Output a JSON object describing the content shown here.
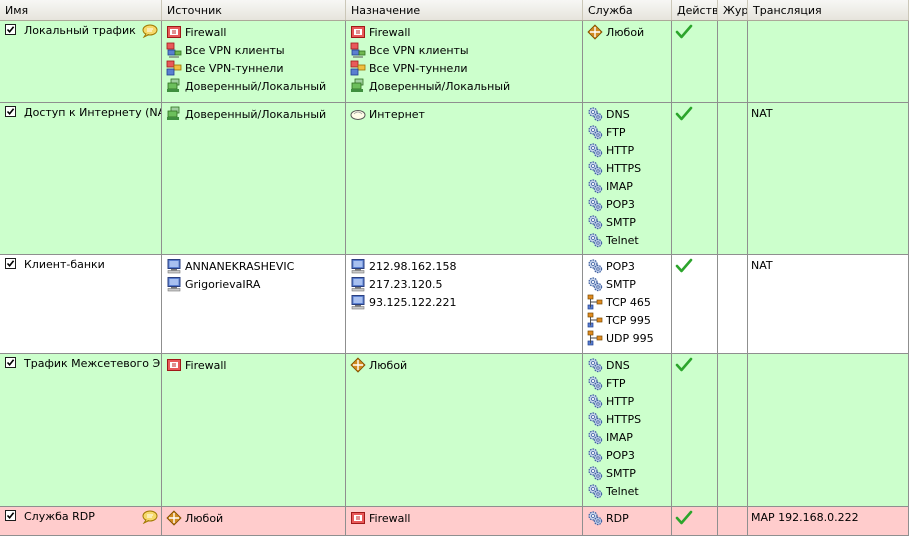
{
  "columns": [
    "Имя",
    "Источник",
    "Назначение",
    "Служба",
    "Действи",
    "Журн",
    "Трансляция"
  ],
  "rules": [
    {
      "name": "Локальный трафик",
      "color": "green",
      "comment": true,
      "source": [
        {
          "icon": "firewall-icon",
          "text": "Firewall"
        },
        {
          "icon": "vpn-clients-icon",
          "text": "Все VPN клиенты"
        },
        {
          "icon": "vpn-tunnels-icon",
          "text": "Все VPN-туннели"
        },
        {
          "icon": "trusted-network-icon",
          "text": "Доверенный/Локальный"
        }
      ],
      "destination": [
        {
          "icon": "firewall-icon",
          "text": "Firewall"
        },
        {
          "icon": "vpn-clients-icon",
          "text": "Все VPN клиенты"
        },
        {
          "icon": "vpn-tunnels-icon",
          "text": "Все VPN-туннели"
        },
        {
          "icon": "trusted-network-icon",
          "text": "Доверенный/Локальный"
        }
      ],
      "service": [
        {
          "icon": "any-icon",
          "text": "Любой"
        }
      ],
      "action": "allow",
      "translation": ""
    },
    {
      "name": "Доступ к Интернету (NAT)",
      "color": "green",
      "comment": false,
      "source": [
        {
          "icon": "trusted-network-icon",
          "text": "Доверенный/Локальный"
        }
      ],
      "destination": [
        {
          "icon": "internet-icon",
          "text": "Интернет"
        }
      ],
      "service": [
        {
          "icon": "service-gears-icon",
          "text": "DNS"
        },
        {
          "icon": "service-gears-icon",
          "text": "FTP"
        },
        {
          "icon": "service-gears-icon",
          "text": "HTTP"
        },
        {
          "icon": "service-gears-icon",
          "text": "HTTPS"
        },
        {
          "icon": "service-gears-icon",
          "text": "IMAP"
        },
        {
          "icon": "service-gears-icon",
          "text": "POP3"
        },
        {
          "icon": "service-gears-icon",
          "text": "SMTP"
        },
        {
          "icon": "service-gears-icon",
          "text": "Telnet"
        }
      ],
      "action": "allow",
      "translation": "NAT"
    },
    {
      "name": "Клиент-банки",
      "color": "white",
      "comment": false,
      "source": [
        {
          "icon": "computer-icon",
          "text": "ANNANEKRASHEVIC"
        },
        {
          "icon": "computer-icon",
          "text": "GrigorievaIRA"
        }
      ],
      "destination": [
        {
          "icon": "computer-icon",
          "text": "212.98.162.158"
        },
        {
          "icon": "computer-icon",
          "text": "217.23.120.5"
        },
        {
          "icon": "computer-icon",
          "text": "93.125.122.221"
        }
      ],
      "service": [
        {
          "icon": "service-gears-icon",
          "text": "POP3"
        },
        {
          "icon": "service-gears-icon",
          "text": "SMTP"
        },
        {
          "icon": "port-icon",
          "text": "TCP 465"
        },
        {
          "icon": "port-icon",
          "text": "TCP 995"
        },
        {
          "icon": "port-icon",
          "text": "UDP 995"
        }
      ],
      "action": "allow",
      "translation": "NAT"
    },
    {
      "name": "Трафик Межсетевого Экрана",
      "color": "green",
      "comment": false,
      "source": [
        {
          "icon": "firewall-icon",
          "text": "Firewall"
        }
      ],
      "destination": [
        {
          "icon": "any-icon",
          "text": "Любой"
        }
      ],
      "service": [
        {
          "icon": "service-gears-icon",
          "text": "DNS"
        },
        {
          "icon": "service-gears-icon",
          "text": "FTP"
        },
        {
          "icon": "service-gears-icon",
          "text": "HTTP"
        },
        {
          "icon": "service-gears-icon",
          "text": "HTTPS"
        },
        {
          "icon": "service-gears-icon",
          "text": "IMAP"
        },
        {
          "icon": "service-gears-icon",
          "text": "POP3"
        },
        {
          "icon": "service-gears-icon",
          "text": "SMTP"
        },
        {
          "icon": "service-gears-icon",
          "text": "Telnet"
        }
      ],
      "action": "allow",
      "translation": ""
    },
    {
      "name": "Служба RDP",
      "color": "pink",
      "comment": true,
      "source": [
        {
          "icon": "any-icon",
          "text": "Любой"
        }
      ],
      "destination": [
        {
          "icon": "firewall-icon",
          "text": "Firewall"
        }
      ],
      "service": [
        {
          "icon": "service-gears-icon",
          "text": "RDP"
        }
      ],
      "action": "allow",
      "translation": "MAP 192.168.0.222"
    }
  ]
}
